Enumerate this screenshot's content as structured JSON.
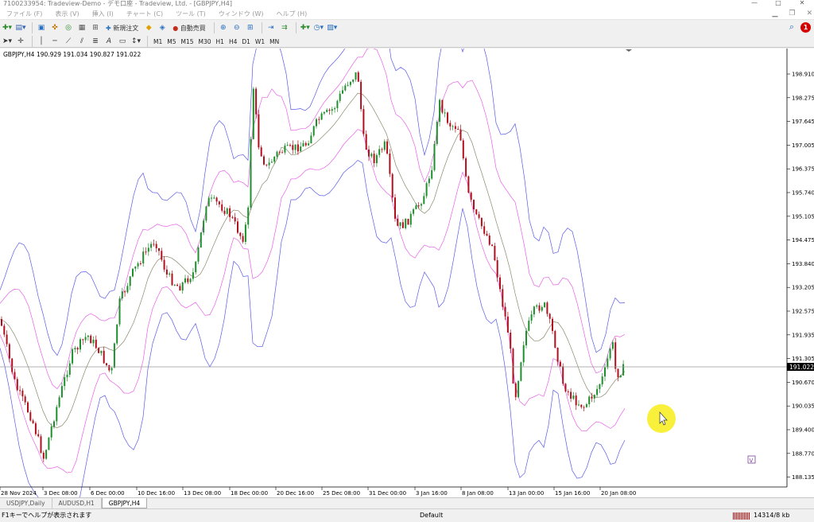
{
  "window": {
    "title": "7100233954: Tradeview-Demo - デモ口座 - Tradeview, Ltd. - [GBPJPY,H4]"
  },
  "menu": [
    "ファイル (F)",
    "表示 (V)",
    "挿入 (I)",
    "チャート (C)",
    "ツール (T)",
    "ウィンドウ (W)",
    "ヘルプ (H)"
  ],
  "toolbar": {
    "new_order_label": "新規注文",
    "autotrade_label": "自動売買",
    "timeframes": [
      "M1",
      "M5",
      "M15",
      "M30",
      "H1",
      "H4",
      "D1",
      "W1",
      "MN"
    ]
  },
  "chart": {
    "symbol_label": "GBPJPY,H4",
    "ohlc_text": "190.929 191.034 190.827 191.022",
    "current_price": "191.022",
    "price_labels": [
      "198.910",
      "198.275",
      "197.645",
      "197.005",
      "196.375",
      "195.740",
      "195.105",
      "194.475",
      "193.840",
      "193.205",
      "192.575",
      "191.935",
      "191.305",
      "190.670",
      "190.035",
      "189.400",
      "188.770",
      "188.135"
    ],
    "date_labels": [
      "28 Nov 2024",
      "3 Dec 08:00",
      "6 Dec 00:00",
      "10 Dec 16:00",
      "13 Dec 08:00",
      "18 Dec 00:00",
      "20 Dec 16:00",
      "25 Dec 08:00",
      "31 Dec 00:00",
      "3 Jan 16:00",
      "8 Jan 08:00",
      "13 Jan 00:00",
      "15 Jan 16:00",
      "20 Jan 08:00"
    ],
    "colors": {
      "bull": "#1f8f2e",
      "bear": "#b0101e",
      "outer_band": "#5a5ae8",
      "mid_band": "#e860e8",
      "ma": "#8a8a6a"
    }
  },
  "tabs": [
    "USDJPY,Daily",
    "AUDUSD,H1",
    "GBPJPY,H4"
  ],
  "status": {
    "help_text": "F1キーでヘルプが表示されます",
    "profile": "Default",
    "traffic": "14314/8 kb"
  }
}
